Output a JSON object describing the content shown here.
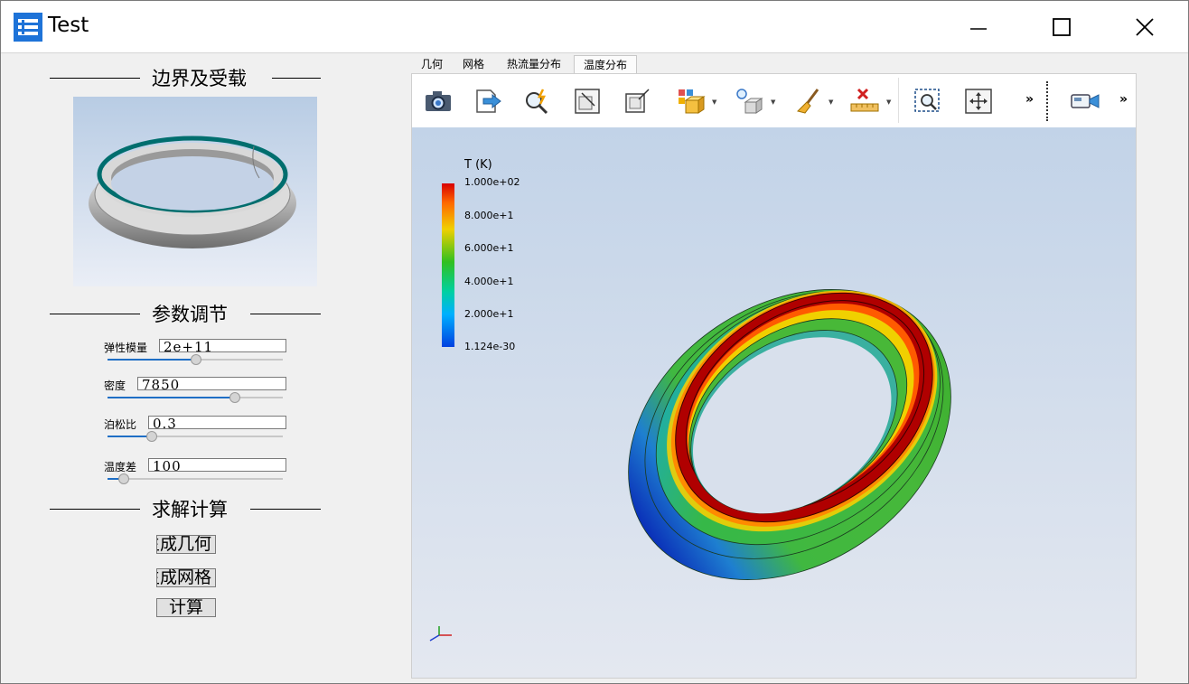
{
  "window": {
    "title": "Test"
  },
  "left": {
    "section_boundary": "边界及受载",
    "section_params": "参数调节",
    "section_solve": "求解计算",
    "params": [
      {
        "label": "弹性模量",
        "value": "2e+11",
        "slider": 0.5
      },
      {
        "label": "密度",
        "value": "7850",
        "slider": 0.73
      },
      {
        "label": "泊松比",
        "value": "0.3",
        "slider": 0.25
      },
      {
        "label": "温度差",
        "value": "100",
        "slider": 0.09
      }
    ],
    "buttons": {
      "gen_geometry": "生成几何",
      "gen_mesh": "生成网格",
      "compute": "计算"
    }
  },
  "tabs": [
    "几何",
    "网格",
    "热流量分布",
    "温度分布"
  ],
  "active_tab": "温度分布",
  "toolbar": [
    "camera-icon",
    "export-icon",
    "interact-select-icon",
    "reset-camera-icon",
    "zoom-to-data-icon",
    "show-hide-icon",
    "light-icon",
    "clear-icon",
    "ruler-icon",
    "zoom-box-icon",
    "pan-icon",
    "camera-settings-icon"
  ],
  "colorbar": {
    "title": "T (K)",
    "ticks": [
      "1.000e+02",
      "8.000e+1",
      "6.000e+1",
      "4.000e+1",
      "2.000e+1",
      "1.124e-30"
    ]
  },
  "colors": {
    "accent": "#1f6fc5",
    "ring_hot": "#b00000",
    "ring_cold": "#0a2fb8",
    "ring_mid": "#3fb53a"
  }
}
